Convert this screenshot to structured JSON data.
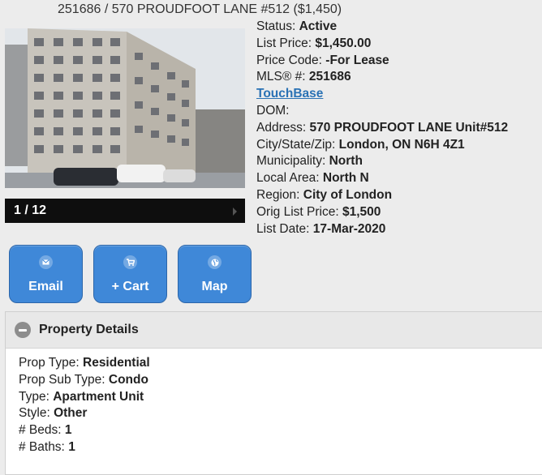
{
  "listing": {
    "title": "251686 / 570 PROUDFOOT LANE #512 ($1,450)"
  },
  "photo": {
    "counter": "1 / 12"
  },
  "info": {
    "status_label": "Status:",
    "status_value": "Active",
    "list_price_label": "List Price:",
    "list_price_value": "$1,450.00",
    "price_code_label": "Price Code:",
    "price_code_value": "-For Lease",
    "mls_label": "MLS® #:",
    "mls_value": "251686",
    "touchbase_link": "TouchBase",
    "dom_label": "DOM:",
    "address_label": "Address:",
    "address_value": "570 PROUDFOOT LANE Unit#512",
    "city_label": "City/State/Zip:",
    "city_value": "London, ON N6H 4Z1",
    "municipality_label": "Municipality:",
    "municipality_value": "North",
    "local_area_label": "Local Area:",
    "local_area_value": "North N",
    "region_label": "Region:",
    "region_value": "City of London",
    "orig_price_label": "Orig List Price:",
    "orig_price_value": "$1,500",
    "list_date_label": "List Date:",
    "list_date_value": "17-Mar-2020"
  },
  "buttons": {
    "email": {
      "label": "Email",
      "icon": "envelope-icon"
    },
    "cart": {
      "label": "+ Cart",
      "icon": "cart-icon"
    },
    "map": {
      "label": "Map",
      "icon": "globe-icon"
    }
  },
  "property_details": {
    "title": "Property Details",
    "prop_type_label": "Prop Type:",
    "prop_type_value": "Residential",
    "prop_sub_type_label": "Prop Sub Type:",
    "prop_sub_type_value": "Condo",
    "type_label": "Type:",
    "type_value": "Apartment Unit",
    "style_label": "Style:",
    "style_value": "Other",
    "beds_label": "# Beds:",
    "beds_value": "1",
    "baths_label": "# Baths:",
    "baths_value": "1"
  },
  "colors": {
    "button_blue": "#3f88d8",
    "link_blue": "#2a72b5",
    "page_bg": "#ececec"
  }
}
